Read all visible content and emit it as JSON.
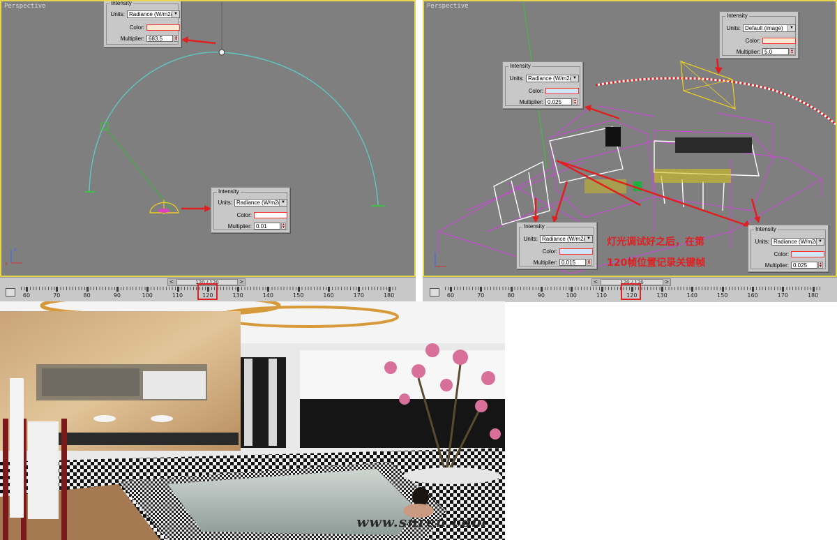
{
  "left_viewport": {
    "label": "Perspective",
    "panels": [
      {
        "title": "Intensity",
        "units_label": "Units:",
        "units_value": "Radiance (W/m2/",
        "color_label": "Color:",
        "color": "#fbe9d6",
        "multiplier_label": "Multiplier:",
        "multiplier": "683.5"
      },
      {
        "title": "Intensity",
        "units_label": "Units:",
        "units_value": "Radiance (W/m2/",
        "color_label": "Color:",
        "color": "#ffffff",
        "multiplier_label": "Multiplier:",
        "multiplier": "0.01"
      }
    ],
    "axis": {
      "x": "x",
      "y": "y",
      "z": "z"
    },
    "timebar": {
      "position": "120 / 120",
      "ticks": [
        "60",
        "70",
        "80",
        "90",
        "100",
        "110",
        "120",
        "130",
        "140",
        "150",
        "160",
        "170",
        "180"
      ]
    }
  },
  "right_viewport": {
    "label": "Perspective",
    "panels": [
      {
        "title": "Intensity",
        "units_label": "Units:",
        "units_value": "Default (image)",
        "color_label": "Color:",
        "color": "#fbe9d6",
        "multiplier_label": "Multiplier:",
        "multiplier": "5.0"
      },
      {
        "title": "Intensity",
        "units_label": "Units:",
        "units_value": "Radiance (W/m2/",
        "color_label": "Color:",
        "color": "#cfe6fb",
        "multiplier_label": "Multiplier:",
        "multiplier": "0.025"
      },
      {
        "title": "Intensity",
        "units_label": "Units:",
        "units_value": "Radiance (W/m2/",
        "color_label": "Color:",
        "color": "#cfe6fb",
        "multiplier_label": "Multiplier:",
        "multiplier": "0.015"
      },
      {
        "title": "Intensity",
        "units_label": "Units:",
        "units_value": "Radiance (W/m2/",
        "color_label": "Color:",
        "color": "#cfe6fb",
        "multiplier_label": "Multiplier:",
        "multiplier": "0.025"
      }
    ],
    "note_line1": "灯光调试好之后，在第",
    "note_line2": "120帧位置记录关键帧",
    "timebar": {
      "position": "120 / 120",
      "ticks": [
        "60",
        "70",
        "80",
        "90",
        "100",
        "110",
        "120",
        "130",
        "140",
        "150",
        "160",
        "170",
        "180"
      ]
    }
  },
  "render": {
    "watermark": "www.snren.com"
  },
  "colors": {
    "viewport_bg": "#7f7f7f",
    "active_border": "#e6d84a",
    "arrow_red": "#e02020",
    "wire_magenta": "#d040e0",
    "arc_cyan": "#5ec8c0"
  }
}
